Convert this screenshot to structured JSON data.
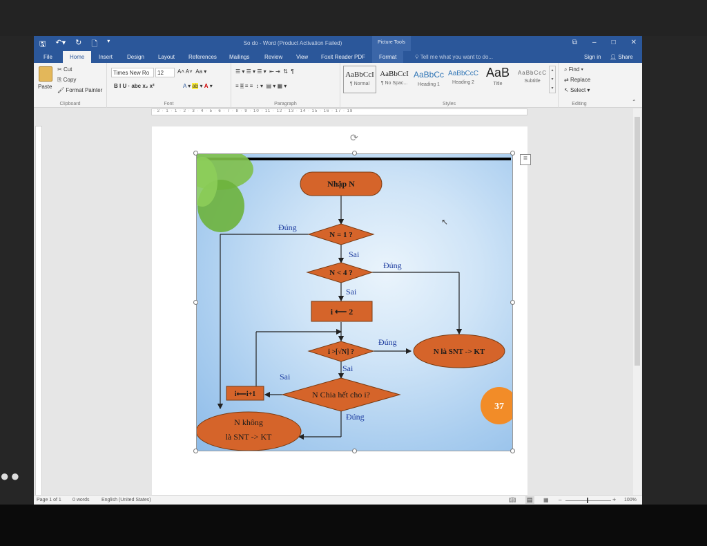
{
  "window": {
    "title": "So do - Word (Product Activation Failed)",
    "context_group": "Picture Tools",
    "controls": [
      "⧉",
      "–",
      "□",
      "✕"
    ]
  },
  "tabs": [
    "File",
    "Home",
    "Insert",
    "Design",
    "Layout",
    "References",
    "Mailings",
    "Review",
    "View",
    "Foxit Reader PDF",
    "Format"
  ],
  "tell_me": "Tell me what you want to do...",
  "account": {
    "sign_in": "Sign in",
    "share": "Share"
  },
  "clipboard": {
    "paste": "Paste",
    "cut": "Cut",
    "copy": "Copy",
    "format_painter": "Format Painter",
    "label": "Clipboard"
  },
  "font": {
    "name": "Times New Ro",
    "size": "12",
    "label": "Font",
    "buttons": "B  I  U  ·  abc  x₂  x²"
  },
  "paragraph": {
    "label": "Paragraph"
  },
  "styles": {
    "label": "Styles",
    "items": [
      {
        "sample": "AaBbCcI",
        "name": "¶ Normal"
      },
      {
        "sample": "AaBbCcI",
        "name": "¶ No Spac..."
      },
      {
        "sample": "AaBbCc",
        "name": "Heading 1"
      },
      {
        "sample": "AaBbCcC",
        "name": "Heading 2"
      },
      {
        "sample": "AaB",
        "name": "Title"
      },
      {
        "sample": "AaBbCcC",
        "name": "Subtitle"
      }
    ]
  },
  "editing": {
    "label": "Editing",
    "find": "Find",
    "replace": "Replace",
    "select": "Select"
  },
  "ruler_text": "· 2 · 1 · 1 · 2 · 3 · 4 · 5 · 6 · 7 · 8 · 9 · 10 · 11 · 12 · 13 · 14 · 15 · 16 · 17 · 18",
  "status": {
    "page": "Page 1 of 1",
    "words": "0 words",
    "language": "English (United States)",
    "zoom": "100%"
  },
  "flowchart": {
    "start": "Nhập N",
    "cond_n1": "N = 1 ?",
    "cond_n4": "N < 4  ?",
    "assign_i": "i ⟵ 2",
    "cond_sqrt": "i >[√N] ?",
    "cond_div": "N Chia hết cho i?",
    "incr": "i⟵i+1",
    "is_prime": "N là SNT -> KT",
    "not_prime_1": "N không",
    "not_prime_2": "là SNT -> KT",
    "yes": "Đúng",
    "no": "Sai",
    "badge": "37"
  }
}
